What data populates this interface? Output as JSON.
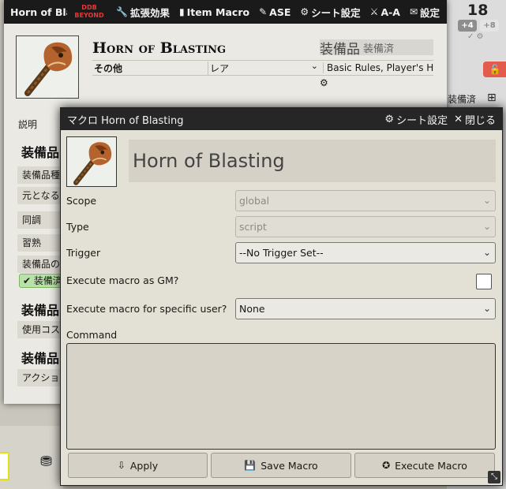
{
  "right_panel": {
    "number": "18",
    "plus_a": "+4",
    "plus_b": "+8",
    "mini_icons": "✓ ⚙",
    "equipped_label": "装備済",
    "grid_icon": "⊞",
    "unlock_icon": "🔓"
  },
  "item_sheet": {
    "window_title": "Horn of Bla",
    "ddb_logo": "DDB\nBEYOND",
    "header_buttons": [
      {
        "icon": "🔧",
        "label": "拡張効果"
      },
      {
        "icon": "▮",
        "label": "Item Macro"
      },
      {
        "icon": "✎",
        "label": "ASE"
      },
      {
        "icon": "⚙",
        "label": "シート設定"
      },
      {
        "icon": "⚔",
        "label": "A-A"
      },
      {
        "icon": "✉",
        "label": "設定"
      }
    ],
    "item_name": "Horn of Blasting",
    "item_type": "装備品",
    "equipped_status": "装備済",
    "category": "その他",
    "rarity": "レア",
    "source": "Basic Rules, Player's Ha",
    "tab_description": "説明",
    "side_heading_1": "装備品",
    "side_rows": [
      "装備品種",
      "元となる",
      "同調",
      "習熟",
      "装備品の"
    ],
    "equipped_badge": "装備済",
    "side_heading_2": "装備品",
    "usage_row": "使用コス",
    "side_heading_3": "装備品",
    "action_row": "アクショ"
  },
  "macro_window": {
    "title": "マクロ Horn of Blasting",
    "sheet_settings": "シート設定",
    "close": "閉じる",
    "macro_name": "Horn of Blasting",
    "fields": {
      "scope": {
        "label": "Scope",
        "value": "global"
      },
      "type": {
        "label": "Type",
        "value": "script"
      },
      "trigger": {
        "label": "Trigger",
        "value": "--No Trigger Set--"
      },
      "execute_as_gm": {
        "label": "Execute macro as GM?",
        "checked": false
      },
      "specific_user": {
        "label": "Execute macro for specific user?",
        "value": "None"
      },
      "command": {
        "label": "Command",
        "value": ""
      }
    },
    "buttons": {
      "apply": "Apply",
      "save": "Save Macro",
      "execute": "Execute Macro"
    },
    "resize_icon": "⤡"
  },
  "icons": {
    "gear": "⚙",
    "close_x": "✕",
    "chevron": "⌄",
    "check": "✔",
    "apply_icon": "⇩",
    "save_icon": "💾",
    "execute_icon": "✪",
    "coins_icon": "⛃"
  },
  "colors": {
    "titlebar": "#1a1a1a",
    "sheet_bg": "#ebe9e3",
    "macro_bg": "#e3e0d6",
    "unlock_red": "#e25b4c",
    "equipped_green": "#b9e2a9"
  }
}
